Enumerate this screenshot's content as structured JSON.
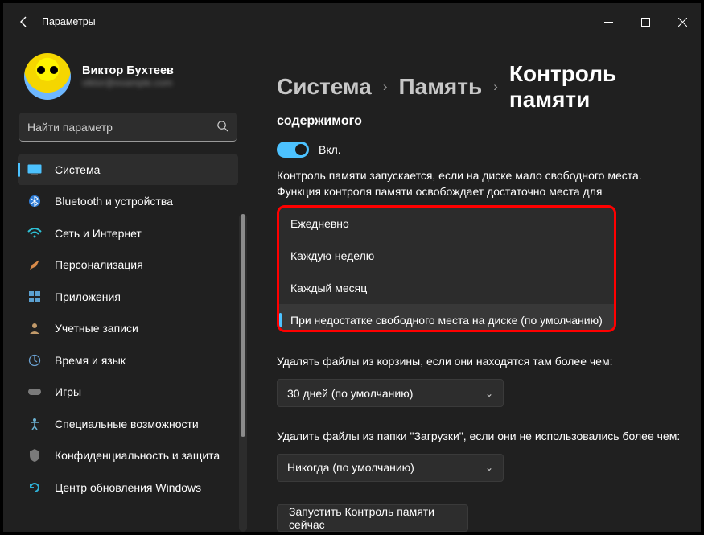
{
  "window": {
    "title": "Параметры"
  },
  "profile": {
    "name": "Виктор Бухтеев",
    "email": "viktor@example.com"
  },
  "search": {
    "placeholder": "Найти параметр"
  },
  "sidebar": {
    "items": [
      {
        "label": "Система"
      },
      {
        "label": "Bluetooth и устройства"
      },
      {
        "label": "Сеть и Интернет"
      },
      {
        "label": "Персонализация"
      },
      {
        "label": "Приложения"
      },
      {
        "label": "Учетные записи"
      },
      {
        "label": "Время и язык"
      },
      {
        "label": "Игры"
      },
      {
        "label": "Специальные возможности"
      },
      {
        "label": "Конфиденциальность и защита"
      },
      {
        "label": "Центр обновления Windows"
      }
    ]
  },
  "breadcrumb": {
    "system": "Система",
    "storage": "Память",
    "current": "Контроль памяти"
  },
  "content": {
    "section_title": "содержимого",
    "toggle_label": "Вкл.",
    "description": "Контроль памяти запускается, если на диске мало свободного места. Функция контроля памяти освобождает достаточно места для",
    "frequency_options": [
      "Ежедневно",
      "Каждую неделю",
      "Каждый месяц",
      "При недостатке свободного места на диске (по умолчанию)"
    ],
    "recycle_label": "Удалять файлы из корзины, если они находятся там более чем:",
    "recycle_value": "30 дней (по умолчанию)",
    "downloads_label": "Удалить файлы из папки \"Загрузки\", если они не использовались более чем:",
    "downloads_value": "Никогда (по умолчанию)",
    "run_now": "Запустить Контроль памяти сейчас"
  }
}
